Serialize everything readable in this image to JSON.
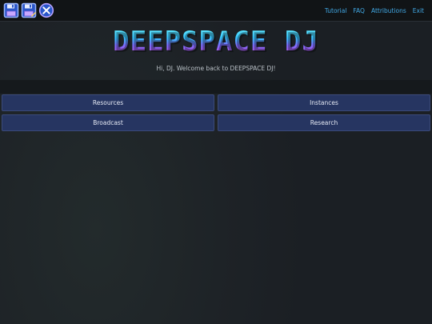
{
  "toolbar": {
    "icons": [
      {
        "name": "save-icon",
        "tooltip": ""
      },
      {
        "name": "save-as-icon",
        "tooltip": ""
      },
      {
        "name": "close-circle-icon",
        "tooltip": ""
      }
    ]
  },
  "nav": {
    "items": [
      {
        "label": "Tutorial"
      },
      {
        "label": "FAQ"
      },
      {
        "label": "Attributions"
      },
      {
        "label": "Exit"
      }
    ]
  },
  "hero": {
    "logo_text": "DEEPSPACE DJ",
    "welcome": "Hi, DJ. Welcome back to DEEPSPACE DJ!"
  },
  "menu": {
    "buttons": [
      {
        "label": "Resources"
      },
      {
        "label": "Instances"
      },
      {
        "label": "Broadcast"
      },
      {
        "label": "Research"
      }
    ]
  },
  "colors": {
    "link": "#41a9e6",
    "button_bg": "#263561",
    "icon_accent": "#2f6bff"
  }
}
